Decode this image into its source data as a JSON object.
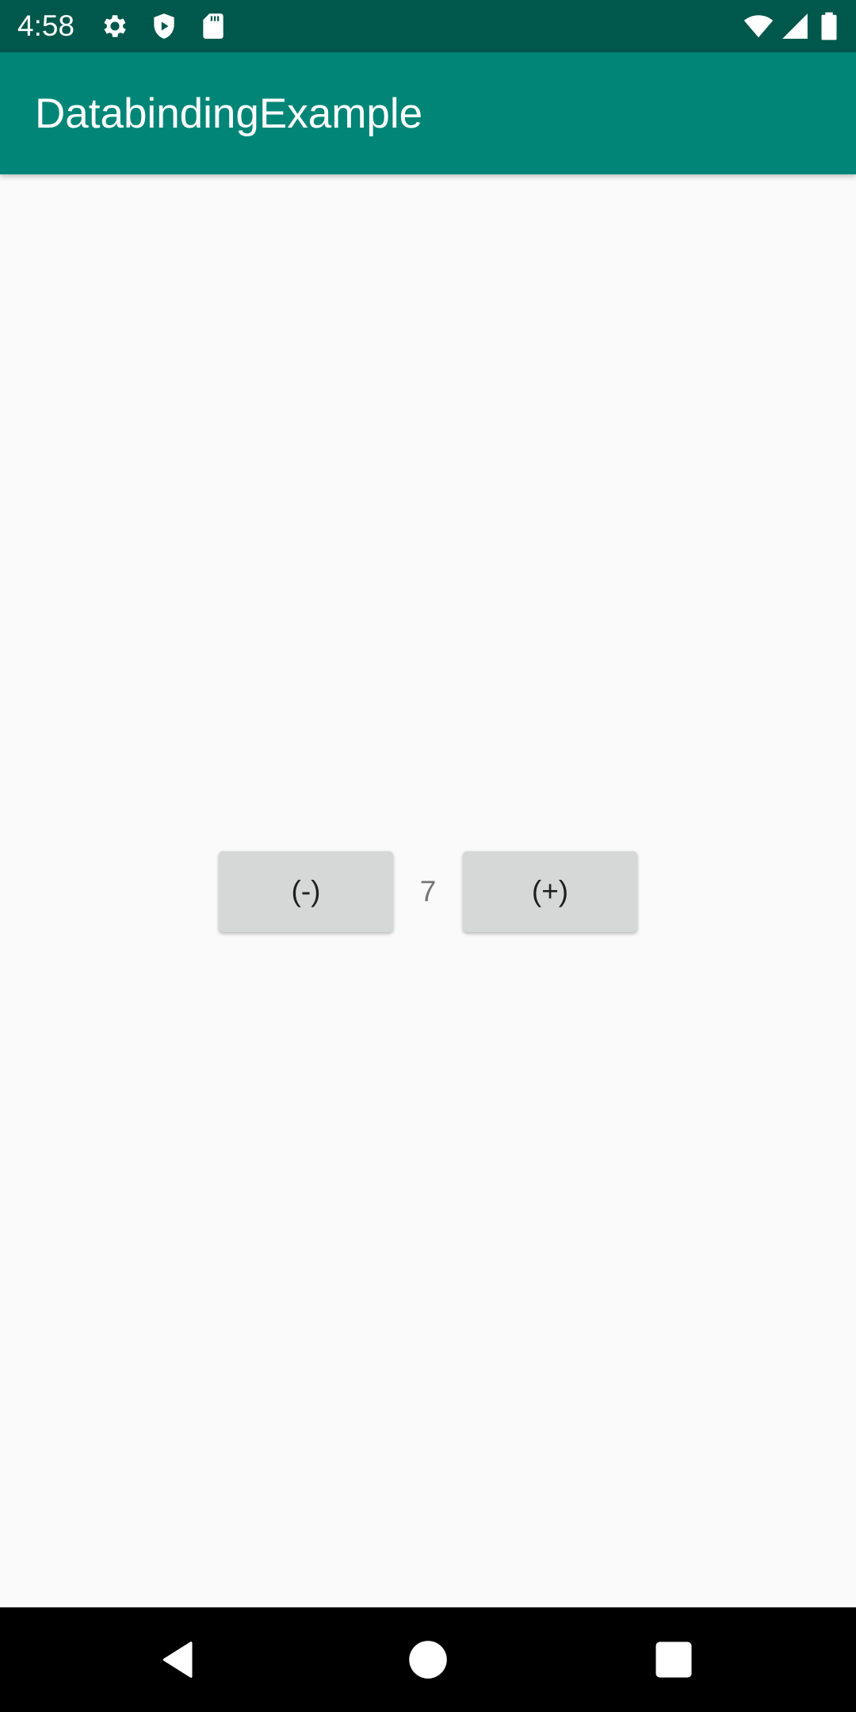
{
  "status_bar": {
    "time": "4:58",
    "left_icons": [
      "gear-icon",
      "shield-icon",
      "sd-card-icon"
    ],
    "right_icons": [
      "wifi-icon",
      "cell-signal-icon",
      "battery-icon"
    ],
    "background": "#00574b"
  },
  "app_bar": {
    "title": "DatabindingExample",
    "background": "#008577"
  },
  "counter": {
    "decrement_label": "(-)",
    "value": "7",
    "increment_label": "(+)"
  },
  "nav_bar": {
    "icons": [
      "back-icon",
      "home-icon",
      "recents-icon"
    ]
  }
}
